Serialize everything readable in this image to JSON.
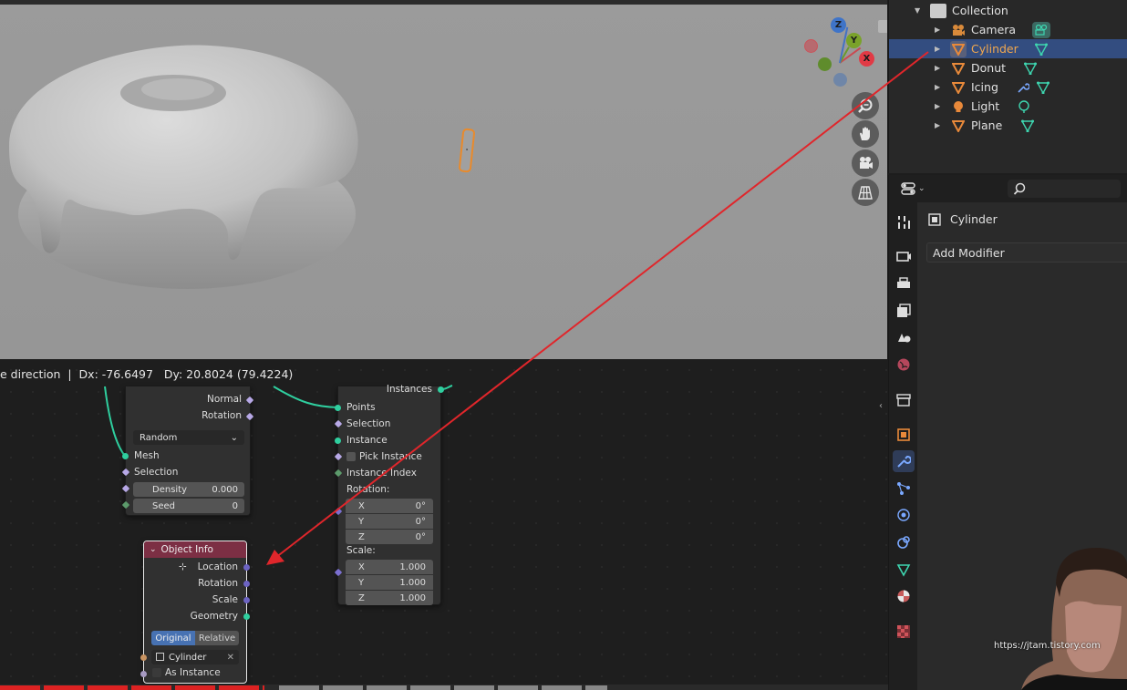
{
  "viewport": {
    "gizmo": {
      "z": "Z",
      "y": "Y",
      "x": "X"
    },
    "nav_buttons": [
      "zoom-icon",
      "hand-pan-icon",
      "camera-view-icon",
      "ortho-grid-icon"
    ]
  },
  "node_editor": {
    "drag_status": "e direction  |  Dx: -76.6497   Dy: 20.8024 (79.4224)",
    "distribute_node": {
      "outputs": [
        "Normal",
        "Rotation"
      ],
      "mode": "Random",
      "inputs": [
        "Mesh",
        "Selection"
      ],
      "density_label": "Density",
      "density_value": "0.000",
      "seed_label": "Seed",
      "seed_value": "0"
    },
    "instance_node": {
      "output": "Instances",
      "inputs": [
        "Points",
        "Selection",
        "Instance"
      ],
      "pick_instance": "Pick Instance",
      "instance_index": "Instance Index",
      "rotation_label": "Rotation:",
      "rotation": [
        {
          "axis": "X",
          "value": "0°"
        },
        {
          "axis": "Y",
          "value": "0°"
        },
        {
          "axis": "Z",
          "value": "0°"
        }
      ],
      "scale_label": "Scale:",
      "scale": [
        {
          "axis": "X",
          "value": "1.000"
        },
        {
          "axis": "Y",
          "value": "1.000"
        },
        {
          "axis": "Z",
          "value": "1.000"
        }
      ]
    },
    "object_info_node": {
      "title": "Object Info",
      "outputs": [
        "Location",
        "Rotation",
        "Scale",
        "Geometry"
      ],
      "mode_original": "Original",
      "mode_relative": "Relative",
      "object": "Cylinder",
      "as_instance": "As Instance"
    }
  },
  "outliner": {
    "collection": "Collection",
    "items": [
      {
        "label": "Camera"
      },
      {
        "label": "Cylinder",
        "selected": true
      },
      {
        "label": "Donut"
      },
      {
        "label": "Icing"
      },
      {
        "label": "Light"
      },
      {
        "label": "Plane"
      }
    ]
  },
  "properties": {
    "object_name": "Cylinder",
    "add_modifier": "Add Modifier"
  },
  "watermark": "https://jtam.tistory.com",
  "colors": {
    "selection_orange": "#e98a2b",
    "annotation_red": "#e0262b",
    "outliner_selected": "#334d80",
    "object_info_header": "#7c2f44"
  }
}
